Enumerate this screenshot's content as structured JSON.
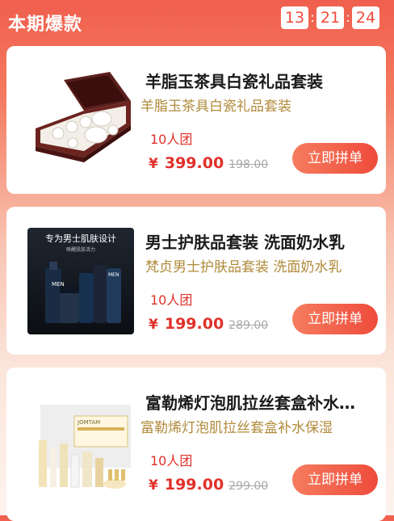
{
  "header": {
    "title": "本期爆款",
    "timer": {
      "hours": "13",
      "minutes": "21",
      "seconds": "24"
    }
  },
  "products": [
    {
      "name": "羊脂玉茶具白瓷礼品套装",
      "subtitle": "羊脂玉茶具白瓷礼品套装",
      "group": "10人团",
      "currency": "¥",
      "price": "399.00",
      "original_price": "198.00",
      "button": "立即拼单"
    },
    {
      "name": "男士护肤品套装 洗面奶水乳",
      "subtitle": "梵贞男士护肤品套装 洗面奶水乳",
      "group": "10人团",
      "currency": "¥",
      "price": "199.00",
      "original_price": "289.00",
      "button": "立即拼单",
      "image_text": {
        "banner": "专为男士肌肤设计",
        "tagline": "唤醒肌肤活力",
        "brand": "MEN"
      }
    },
    {
      "name": "富勒烯灯泡肌拉丝套盒补水保湿",
      "subtitle": "富勒烯灯泡肌拉丝套盒补水保湿",
      "group": "10人团",
      "currency": "¥",
      "price": "199.00",
      "original_price": "299.00",
      "button": "立即拼单",
      "image_text": {
        "brand": "JOMTAM"
      }
    }
  ]
}
